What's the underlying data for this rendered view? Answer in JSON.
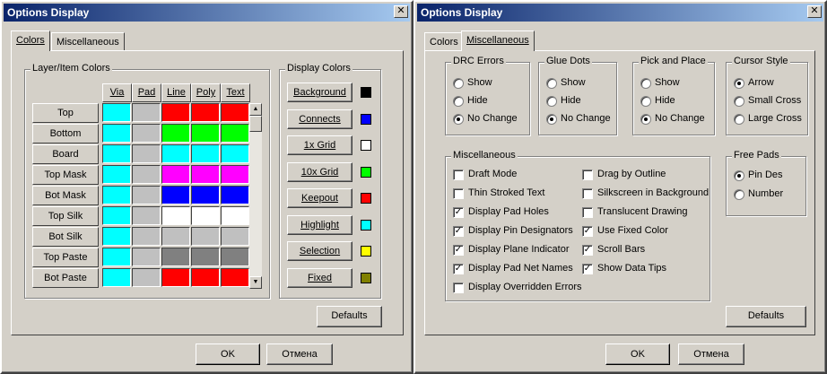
{
  "left": {
    "title": "Options Display",
    "tabs": [
      "Colors",
      "Miscellaneous"
    ],
    "layer_group": "Layer/Item Colors",
    "columns": [
      "Via",
      "Pad",
      "Line",
      "Poly",
      "Text"
    ],
    "rows": [
      {
        "label": "Top",
        "colors": [
          "#00ffff",
          "#c0c0c0",
          "#ff0000",
          "#ff0000",
          "#ff0000"
        ]
      },
      {
        "label": "Bottom",
        "colors": [
          "#00ffff",
          "#c0c0c0",
          "#00ff00",
          "#00ff00",
          "#00ff00"
        ]
      },
      {
        "label": "Board",
        "colors": [
          "#00ffff",
          "#c0c0c0",
          "#00ffff",
          "#00ffff",
          "#00ffff"
        ]
      },
      {
        "label": "Top Mask",
        "colors": [
          "#00ffff",
          "#c0c0c0",
          "#ff00ff",
          "#ff00ff",
          "#ff00ff"
        ]
      },
      {
        "label": "Bot Mask",
        "colors": [
          "#00ffff",
          "#c0c0c0",
          "#0000ff",
          "#0000ff",
          "#0000ff"
        ]
      },
      {
        "label": "Top Silk",
        "colors": [
          "#00ffff",
          "#c0c0c0",
          "#ffffff",
          "#ffffff",
          "#ffffff"
        ]
      },
      {
        "label": "Bot Silk",
        "colors": [
          "#00ffff",
          "#c0c0c0",
          "#c0c0c0",
          "#c0c0c0",
          "#c0c0c0"
        ]
      },
      {
        "label": "Top Paste",
        "colors": [
          "#00ffff",
          "#c0c0c0",
          "#808080",
          "#808080",
          "#808080"
        ]
      },
      {
        "label": "Bot Paste",
        "colors": [
          "#00ffff",
          "#c0c0c0",
          "#ff0000",
          "#ff0000",
          "#ff0000"
        ]
      }
    ],
    "display_group": "Display Colors",
    "display_colors": [
      {
        "label": "Background",
        "color": "#000000"
      },
      {
        "label": "Connects",
        "color": "#0000ff"
      },
      {
        "label": "1x Grid",
        "color": "#ffffff"
      },
      {
        "label": "10x Grid",
        "color": "#00ff00"
      },
      {
        "label": "Keepout",
        "color": "#ff0000"
      },
      {
        "label": "Highlight",
        "color": "#00ffff"
      },
      {
        "label": "Selection",
        "color": "#ffff00"
      },
      {
        "label": "Fixed",
        "color": "#808000"
      }
    ],
    "defaults_label": "Defaults",
    "ok_label": "OK",
    "cancel_label": "Отмена"
  },
  "right": {
    "title": "Options Display",
    "tabs": [
      "Colors",
      "Miscellaneous"
    ],
    "drc": {
      "label": "DRC Errors",
      "options": [
        "Show",
        "Hide",
        "No Change"
      ],
      "selected": 2
    },
    "glue": {
      "label": "Glue Dots",
      "options": [
        "Show",
        "Hide",
        "No Change"
      ],
      "selected": 2
    },
    "pick": {
      "label": "Pick and Place",
      "options": [
        "Show",
        "Hide",
        "No Change"
      ],
      "selected": 2
    },
    "cursor": {
      "label": "Cursor Style",
      "options": [
        "Arrow",
        "Small Cross",
        "Large Cross"
      ],
      "selected": 0
    },
    "misc": {
      "label": "Miscellaneous",
      "col1": [
        {
          "label": "Draft Mode",
          "checked": false
        },
        {
          "label": "Thin Stroked Text",
          "checked": false
        },
        {
          "label": "Display Pad Holes",
          "checked": true
        },
        {
          "label": "Display Pin Designators",
          "checked": true
        },
        {
          "label": "Display Plane Indicator",
          "checked": true
        },
        {
          "label": "Display Pad Net Names",
          "checked": true
        },
        {
          "label": "Display Overridden Errors",
          "checked": false
        }
      ],
      "col2": [
        {
          "label": "Drag by Outline",
          "checked": false
        },
        {
          "label": "Silkscreen in Background",
          "checked": false
        },
        {
          "label": "Translucent Drawing",
          "checked": false
        },
        {
          "label": "Use Fixed Color",
          "checked": true
        },
        {
          "label": "Scroll Bars",
          "checked": true
        },
        {
          "label": "Show Data Tips",
          "checked": true
        }
      ]
    },
    "freepads": {
      "label": "Free Pads",
      "options": [
        "Pin Des",
        "Number"
      ],
      "selected": 0
    },
    "defaults_label": "Defaults",
    "ok_label": "OK",
    "cancel_label": "Отмена"
  }
}
